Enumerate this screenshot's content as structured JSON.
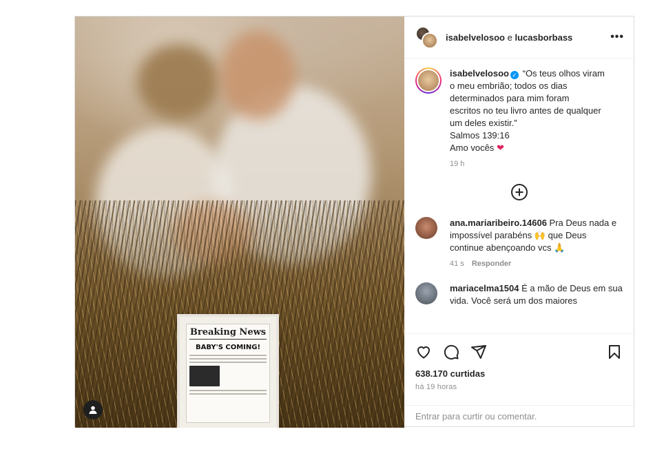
{
  "header": {
    "user1": "isabelvelosoo",
    "joiner": "e",
    "user2": "lucasborbass",
    "more_icon": "more-horizontal-icon"
  },
  "photo": {
    "newspaper_title": "Breaking News",
    "newspaper_headline": "BABY'S COMING!",
    "tag_icon": "user-tag-icon"
  },
  "caption": {
    "username": "isabelvelosoo",
    "verified_icon": "verified-badge-icon",
    "lines": [
      "“Os teus olhos viram",
      "o meu embrião; todos os dias",
      "determinados para mim foram",
      "escritos no teu livro antes de qualquer",
      "um deles existir.”",
      "Salmos 139:16"
    ],
    "closing": "Amo vocês",
    "closing_emoji": "❤",
    "time": "19 h"
  },
  "load_more_icon": "plus-circle-icon",
  "comments": [
    {
      "username": "ana.mariaribeiro.14606",
      "text_a": "Pra Deus nada e impossível parabéns",
      "emoji_a": "🙌",
      "text_b": "que Deus continue abençoando vcs",
      "emoji_b": "🙏",
      "time": "41 s",
      "reply": "Responder"
    },
    {
      "username": "mariacelma1504",
      "text": "É a mão de Deus em sua vida. Você será um dos maiores"
    }
  ],
  "actions": {
    "like_icon": "heart-icon",
    "comment_icon": "comment-icon",
    "share_icon": "send-icon",
    "save_icon": "bookmark-icon",
    "likes": "638.170 curtidas",
    "posted": "há 19 horas"
  },
  "footer": {
    "login_link": "Entrar",
    "login_rest": "para curtir ou comentar."
  },
  "colors": {
    "verified": "#0095f6",
    "muted_text": "#8e8e8e",
    "text": "#262626",
    "heart": "#e0245e"
  }
}
